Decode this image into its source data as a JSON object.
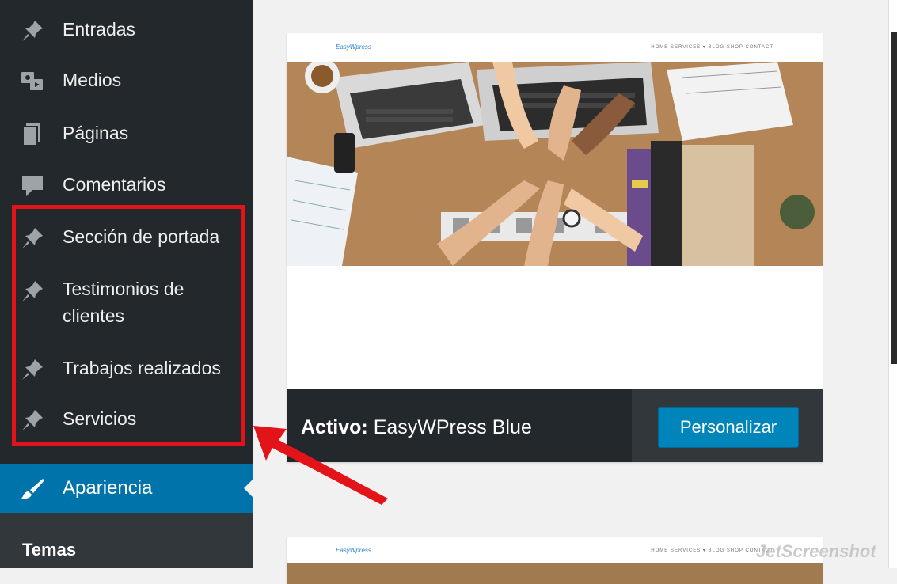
{
  "sidebar": {
    "items": [
      {
        "label": "Entradas",
        "icon": "pin-icon"
      },
      {
        "label": "Medios",
        "icon": "media-icon"
      },
      {
        "label": "Páginas",
        "icon": "pages-icon"
      },
      {
        "label": "Comentarios",
        "icon": "comments-icon"
      },
      {
        "label": "Sección de portada",
        "icon": "pin-icon"
      },
      {
        "label": "Testimonios de clientes",
        "icon": "pin-icon"
      },
      {
        "label": "Trabajos realizados",
        "icon": "pin-icon"
      },
      {
        "label": "Servicios",
        "icon": "pin-icon"
      }
    ],
    "active": {
      "label": "Apariencia",
      "icon": "paintbrush-icon"
    },
    "submenu": {
      "label": "Temas"
    }
  },
  "theme_card": {
    "logo": "EasyWpress",
    "nav": "HOME   SERVICES ▾   BLOG   SHOP   CONTACT",
    "active_prefix": "Activo:",
    "active_name": "EasyWPress Blue",
    "customize_label": "Personalizar"
  },
  "second_card": {
    "logo": "EasyWpress",
    "nav": "HOME   SERVICES ▾   BLOG   SHOP   CONTACT"
  },
  "watermark": "JetScreenshot",
  "colors": {
    "sidebar_bg": "#23282d",
    "active_bg": "#0073aa",
    "button_bg": "#0085ba",
    "highlight": "#e2141a"
  }
}
